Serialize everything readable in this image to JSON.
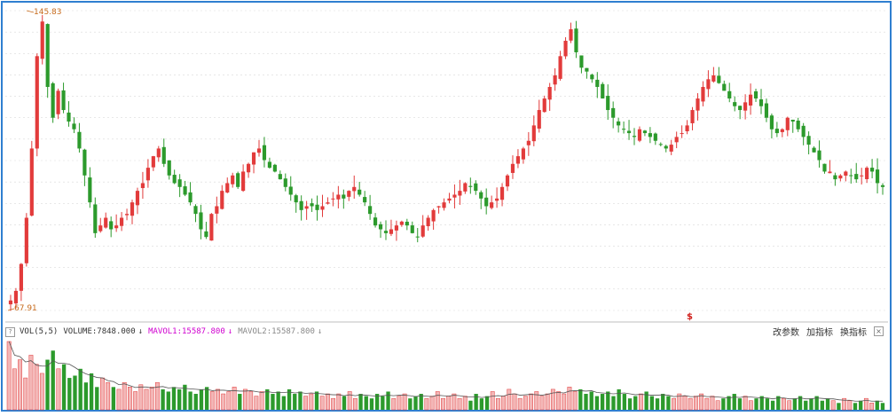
{
  "chart_data": {
    "type": "candlestick",
    "price_high_label": "145.83",
    "price_low_label": "67.91",
    "ylim": [
      67.91,
      145.83
    ],
    "colors": {
      "up": "#e23b3b",
      "down": "#2c9a2c",
      "grid": "#d9d9d9",
      "ma": "#555555"
    },
    "close_series": [
      70.5,
      73,
      80,
      92,
      110,
      134,
      143,
      126,
      118,
      125,
      120,
      117,
      115,
      110,
      103,
      96,
      88,
      90,
      92,
      89,
      90,
      92,
      93,
      96,
      99,
      101,
      105,
      108,
      110,
      106,
      103,
      101,
      100,
      98,
      96,
      93,
      89,
      87,
      93,
      95,
      99,
      101,
      103,
      100,
      104,
      106,
      109,
      110,
      107,
      105,
      104,
      102,
      100,
      98,
      96,
      94,
      95,
      95,
      94,
      95,
      96,
      97,
      98,
      97,
      99,
      100,
      98,
      96,
      93,
      90,
      89,
      88,
      89,
      90,
      91,
      90,
      88,
      87,
      90,
      92,
      94,
      95,
      96,
      97,
      98,
      99,
      101,
      100,
      99,
      97,
      95,
      96,
      97,
      100,
      103,
      106,
      108,
      110,
      112,
      116,
      120,
      123,
      126,
      129,
      134,
      138,
      141,
      135,
      131,
      130,
      128,
      126,
      123,
      120,
      118,
      116,
      115,
      114,
      113,
      115,
      114,
      113,
      112,
      111,
      110,
      111,
      113,
      114,
      116,
      120,
      123,
      126,
      128,
      129,
      127,
      125,
      123,
      121,
      120,
      122,
      124,
      123,
      121,
      118,
      115,
      114,
      115,
      118,
      117,
      115,
      113,
      111,
      109,
      107,
      104,
      104,
      102,
      103,
      104,
      103,
      102,
      103,
      105,
      104,
      101,
      100
    ],
    "volume": {
      "label": "VOL(5,5)",
      "volume_value": "VOLUME:7848.000",
      "mavol1": "MAVOL1:15587.800",
      "mavol2": "MAVOL2:15587.800",
      "bars": [
        30,
        18,
        22,
        14,
        24,
        20,
        16,
        22,
        26,
        18,
        20,
        14,
        15,
        18,
        12,
        16,
        10,
        14,
        12,
        10,
        9,
        12,
        10,
        8,
        11,
        9,
        10,
        12,
        9,
        8,
        10,
        9,
        11,
        8,
        7,
        9,
        10,
        8,
        9,
        7,
        8,
        10,
        7,
        9,
        8,
        6,
        8,
        9,
        7,
        8,
        6,
        9,
        7,
        8,
        6,
        7,
        8,
        6,
        7,
        5,
        7,
        6,
        8,
        5,
        7,
        6,
        5,
        7,
        6,
        8,
        5,
        6,
        7,
        5,
        6,
        7,
        5,
        6,
        8,
        5,
        6,
        7,
        5,
        6,
        4,
        7,
        5,
        6,
        8,
        5,
        6,
        9,
        7,
        5,
        6,
        7,
        8,
        6,
        7,
        9,
        8,
        7,
        10,
        8,
        9,
        7,
        8,
        6,
        7,
        8,
        6,
        9,
        7,
        5,
        6,
        7,
        8,
        6,
        5,
        7,
        6,
        5,
        7,
        6,
        5,
        6,
        7,
        5,
        6,
        4,
        5,
        6,
        7,
        5,
        6,
        4,
        5,
        6,
        5,
        4,
        6,
        5,
        4,
        5,
        6,
        4,
        5,
        6,
        4,
        5,
        4,
        3,
        5,
        4,
        3,
        4,
        5,
        3,
        4,
        3
      ]
    }
  },
  "toolbar": {
    "help": "?",
    "change_params": "改参数",
    "add_indicator": "加指标",
    "switch_indicator": "换指标",
    "close": "×"
  },
  "markers": {
    "dollar": "$"
  },
  "arrows": {
    "down": "↓"
  }
}
